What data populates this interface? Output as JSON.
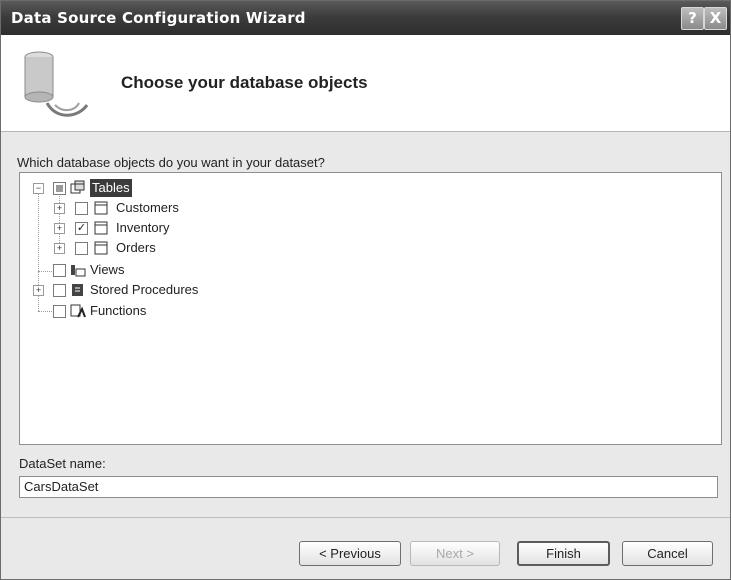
{
  "window": {
    "title": "Data Source Configuration Wizard",
    "help_glyph": "?",
    "close_glyph": "X"
  },
  "header": {
    "title": "Choose your database objects",
    "icon": "database-icon"
  },
  "tree": {
    "prompt": "Which database objects do you want in your dataset?",
    "nodes": {
      "tables": {
        "label": "Tables",
        "state": "partial",
        "expander": "−",
        "icon": "tables-icon"
      },
      "customers": {
        "label": "Customers",
        "state": "unchecked",
        "expander": "+",
        "icon": "table-icon"
      },
      "inventory": {
        "label": "Inventory",
        "state": "checked",
        "expander": "+",
        "icon": "table-icon"
      },
      "orders": {
        "label": "Orders",
        "state": "unchecked",
        "expander": "+",
        "icon": "table-icon"
      },
      "views": {
        "label": "Views",
        "state": "unchecked",
        "icon": "views-icon"
      },
      "stored_procedures": {
        "label": "Stored Procedures",
        "state": "unchecked",
        "expander": "+",
        "icon": "stored-procedures-icon"
      },
      "functions": {
        "label": "Functions",
        "state": "unchecked",
        "icon": "functions-icon"
      }
    },
    "check_glyph": "✓"
  },
  "dataset": {
    "label": "DataSet name:",
    "value": "CarsDataSet"
  },
  "buttons": {
    "previous": "< Previous",
    "next": "Next >",
    "finish": "Finish",
    "cancel": "Cancel"
  }
}
